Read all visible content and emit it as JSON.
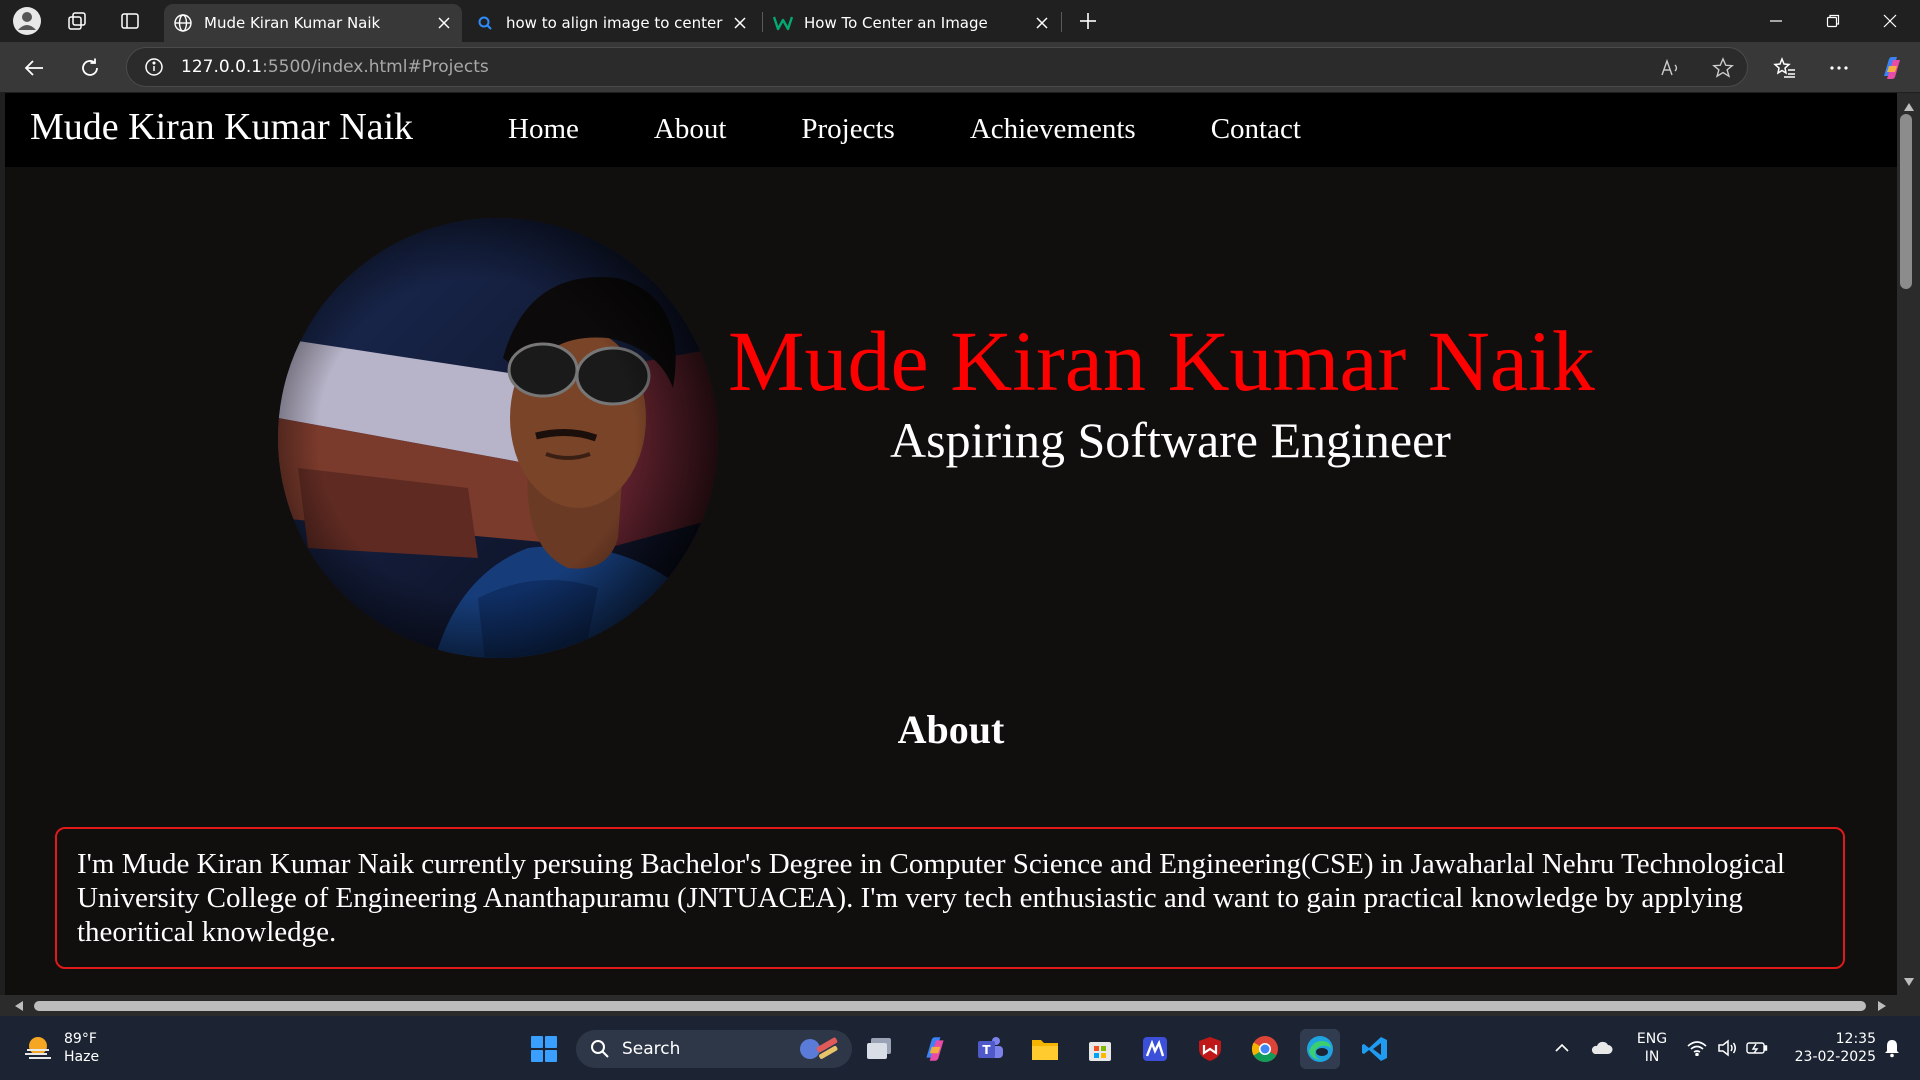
{
  "browser": {
    "tabs": [
      {
        "title": "Mude Kiran Kumar Naik",
        "active": true,
        "favicon": "globe-icon"
      },
      {
        "title": "how to align image to center - Se",
        "active": false,
        "favicon": "bing-search-icon"
      },
      {
        "title": "How To Center an Image",
        "active": false,
        "favicon": "w3schools-icon"
      }
    ],
    "address": {
      "host": "127.0.0.1",
      "path": ":5500/index.html#Projects"
    }
  },
  "site": {
    "brand": "Mude Kiran Kumar Naik",
    "nav": [
      "Home",
      "About",
      "Projects",
      "Achievements",
      "Contact"
    ],
    "hero": {
      "name": "Mude Kiran Kumar Naik",
      "subtitle": "Aspiring Software Engineer"
    },
    "about": {
      "heading": "About",
      "text": "I'm Mude Kiran Kumar Naik currently persuing Bachelor's Degree in Computer Science and Engineering(CSE) in Jawaharlal Nehru Technological University College of Engineering Ananthapuramu (JNTUACEA). I'm very tech enthusiastic and want to gain practical knowledge by applying theoritical knowledge."
    },
    "colors": {
      "accent": "#ff0000",
      "background": "#110e0e",
      "nav_bg": "#000000"
    }
  },
  "taskbar": {
    "weather": {
      "temp": "89°F",
      "condition": "Haze"
    },
    "search_label": "Search",
    "language": {
      "line1": "ENG",
      "line2": "IN"
    },
    "clock": {
      "time": "12:35",
      "date": "23-02-2025"
    }
  }
}
